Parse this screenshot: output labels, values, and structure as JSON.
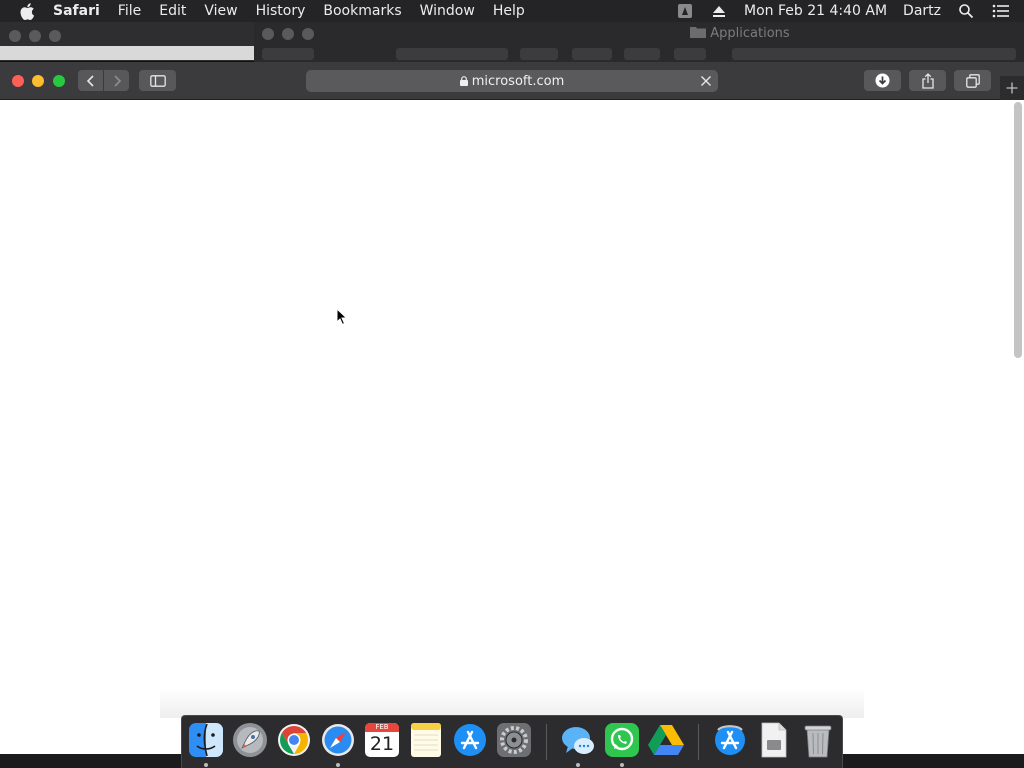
{
  "menubar": {
    "app_name": "Safari",
    "items": [
      "File",
      "Edit",
      "View",
      "History",
      "Bookmarks",
      "Window",
      "Help"
    ],
    "datetime": "Mon Feb 21  4:40 AM",
    "user": "Dartz"
  },
  "background_window": {
    "title": "Applications"
  },
  "safari": {
    "url": "microsoft.com"
  },
  "dock": {
    "calendar_month": "FEB",
    "calendar_day": "21",
    "apps": [
      "Finder",
      "Launchpad",
      "Google Chrome",
      "Safari",
      "Calendar",
      "Notes",
      "App Store",
      "System Preferences",
      "Messages",
      "WhatsApp",
      "Google Drive",
      "App Store Installer",
      "Document",
      "Trash"
    ]
  }
}
